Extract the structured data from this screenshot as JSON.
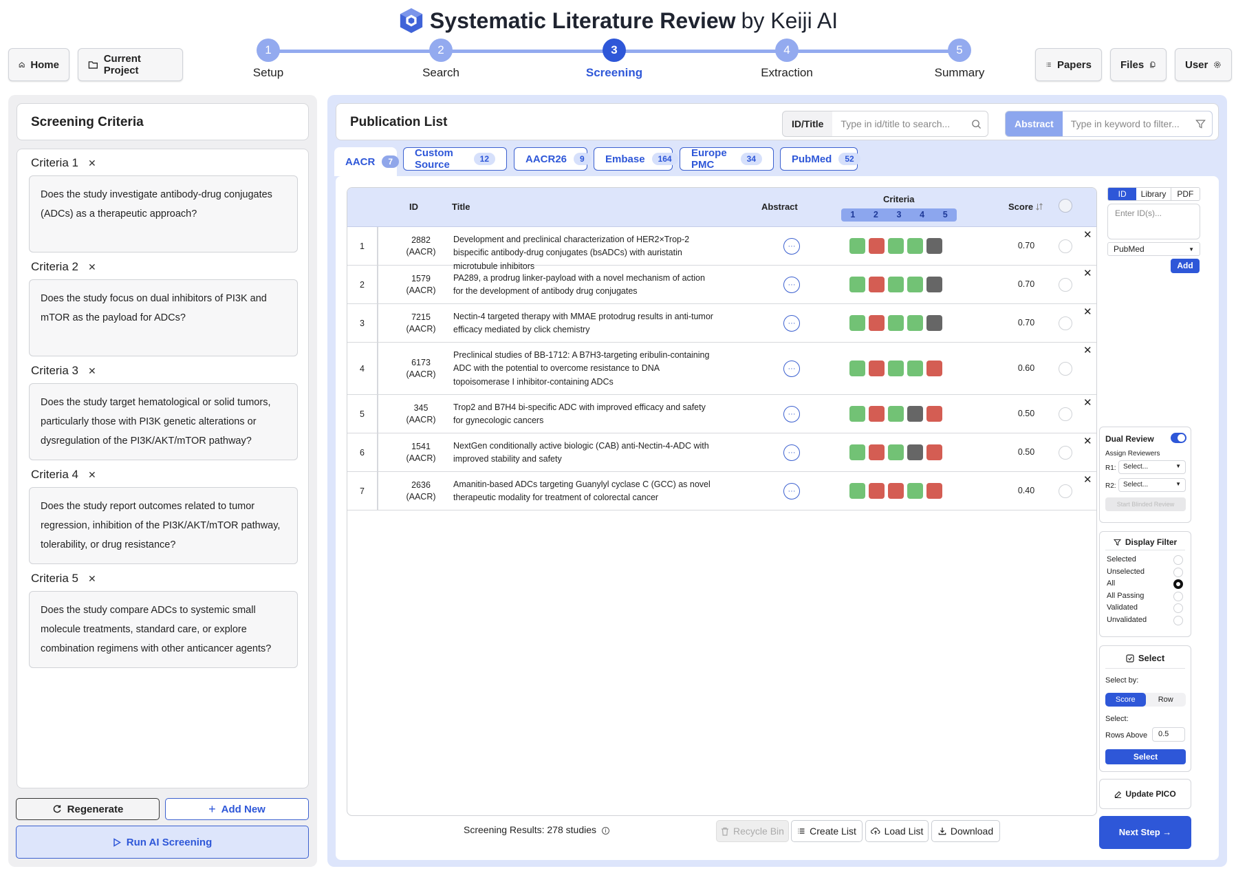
{
  "app": {
    "title_bold": "Systematic Literature Review",
    "title_rest": "by Keiji AI"
  },
  "nav_left": {
    "home": "Home",
    "current_project": "Current Project"
  },
  "nav_right": {
    "papers": "Papers",
    "files": "Files",
    "user": "User"
  },
  "steps": [
    {
      "num": "1",
      "label": "Setup"
    },
    {
      "num": "2",
      "label": "Search"
    },
    {
      "num": "3",
      "label": "Screening",
      "active": true
    },
    {
      "num": "4",
      "label": "Extraction"
    },
    {
      "num": "5",
      "label": "Summary"
    }
  ],
  "criteria_panel": {
    "title": "Screening Criteria",
    "items": [
      {
        "label": "Criteria 1",
        "text": "Does the study investigate antibody-drug conjugates (ADCs) as a therapeutic approach?"
      },
      {
        "label": "Criteria 2",
        "text": "Does the study focus on dual inhibitors of PI3K and mTOR as the payload for ADCs?"
      },
      {
        "label": "Criteria 3",
        "text": "Does the study target hematological or solid tumors, particularly those with PI3K genetic alterations or dysregulation of the PI3K/AKT/mTOR pathway?"
      },
      {
        "label": "Criteria 4",
        "text": "Does the study report outcomes related to tumor regression, inhibition of the PI3K/AKT/mTOR pathway, tolerability, or drug resistance?"
      },
      {
        "label": "Criteria 5",
        "text": "Does the study compare ADCs to systemic small molecule treatments, standard care, or explore combination regimens with other anticancer agents?"
      }
    ],
    "regenerate": "Regenerate",
    "add_new": "Add New",
    "run": "Run AI Screening"
  },
  "publication": {
    "title": "Publication List",
    "search_label": "ID/Title",
    "search_placeholder": "Type in id/title to search...",
    "filter_label": "Abstract",
    "filter_placeholder": "Type in keyword to filter..."
  },
  "tabs": [
    {
      "label": "AACR",
      "count": "7",
      "active": true
    },
    {
      "label": "Custom Source",
      "count": "12"
    },
    {
      "label": "AACR26",
      "count": "9"
    },
    {
      "label": "Embase",
      "count": "164"
    },
    {
      "label": "Europe PMC",
      "count": "34"
    },
    {
      "label": "PubMed",
      "count": "52"
    }
  ],
  "table": {
    "headers": {
      "id": "ID",
      "title": "Title",
      "abstract": "Abstract",
      "criteria": "Criteria",
      "score": "Score"
    },
    "criteria_nums": [
      "1",
      "2",
      "3",
      "4",
      "5"
    ],
    "abstract_glyph": "···",
    "remove_glyph": "✕",
    "rows": [
      {
        "n": "1",
        "id": "2882",
        "src": "(AACR)",
        "title": "Development and preclinical characterization of HER2×Trop-2 bispecific antibody-drug conjugates (bsADCs) with auristatin microtubule inhibitors",
        "criteria": [
          "pass",
          "fail",
          "pass",
          "pass",
          "unknown"
        ],
        "score": "0.70"
      },
      {
        "n": "2",
        "id": "1579",
        "src": "(AACR)",
        "title": "PA289, a prodrug linker-payload with a novel mechanism of action for the development of antibody drug conjugates",
        "criteria": [
          "pass",
          "fail",
          "pass",
          "pass",
          "unknown"
        ],
        "score": "0.70"
      },
      {
        "n": "3",
        "id": "7215",
        "src": "(AACR)",
        "title": "Nectin-4 targeted therapy with MMAE protodrug results in anti-tumor efficacy mediated by click chemistry",
        "criteria": [
          "pass",
          "fail",
          "pass",
          "pass",
          "unknown"
        ],
        "score": "0.70"
      },
      {
        "n": "4",
        "id": "6173",
        "src": "(AACR)",
        "title": "Preclinical studies of BB-1712: A B7H3-targeting eribulin-containing ADC with the potential to overcome resistance to DNA topoisomerase I inhibitor-containing ADCs",
        "criteria": [
          "pass",
          "fail",
          "pass",
          "pass",
          "fail"
        ],
        "score": "0.60"
      },
      {
        "n": "5",
        "id": "345",
        "src": "(AACR)",
        "title": "Trop2 and B7H4 bi-specific ADC with improved efficacy and safety for gynecologic cancers",
        "criteria": [
          "pass",
          "fail",
          "pass",
          "unknown",
          "fail"
        ],
        "score": "0.50"
      },
      {
        "n": "6",
        "id": "1541",
        "src": "(AACR)",
        "title": "NextGen conditionally active biologic (CAB) anti-Nectin-4-ADC with improved stability and safety",
        "criteria": [
          "pass",
          "fail",
          "pass",
          "unknown",
          "fail"
        ],
        "score": "0.50"
      },
      {
        "n": "7",
        "id": "2636",
        "src": "(AACR)",
        "title": "Amanitin-based ADCs targeting Guanylyl cyclase C (GCC) as novel therapeutic modality for treatment of colorectal cancer",
        "criteria": [
          "pass",
          "fail",
          "fail",
          "pass",
          "fail"
        ],
        "score": "0.40"
      }
    ]
  },
  "footer": {
    "results": "Screening Results: 278 studies",
    "recycle": "Recycle Bin",
    "create": "Create List",
    "load": "Load List",
    "download": "Download"
  },
  "right": {
    "tabs": [
      "ID",
      "Library",
      "PDF"
    ],
    "id_placeholder": "Enter ID(s)...",
    "source": "PubMed",
    "add": "Add",
    "dual_review": "Dual Review",
    "assign": "Assign Reviewers",
    "r1": "R1:",
    "r2": "R2:",
    "r_select": "Select...",
    "start_blinded": "Start Blinded Review",
    "display_filter": "Display Filter",
    "filters": [
      "Selected",
      "Unselected",
      "All",
      "All Passing",
      "Validated",
      "Unvalidated"
    ],
    "filter_selected": "All",
    "select_title": "Select",
    "select_by": "Select by:",
    "seg": [
      "Score",
      "Row"
    ],
    "select_label": "Select:",
    "rows_above": "Rows Above",
    "rows_above_value": "0.5",
    "select_btn": "Select",
    "update_pico": "Update PICO",
    "next_step": "Next Step →"
  },
  "colors": {
    "accent": "#2e57d8",
    "step_light": "#93aaef",
    "pass": "#72c275",
    "fail": "#d45d53",
    "unknown": "#666666",
    "panel_blue": "#dde5fb"
  }
}
